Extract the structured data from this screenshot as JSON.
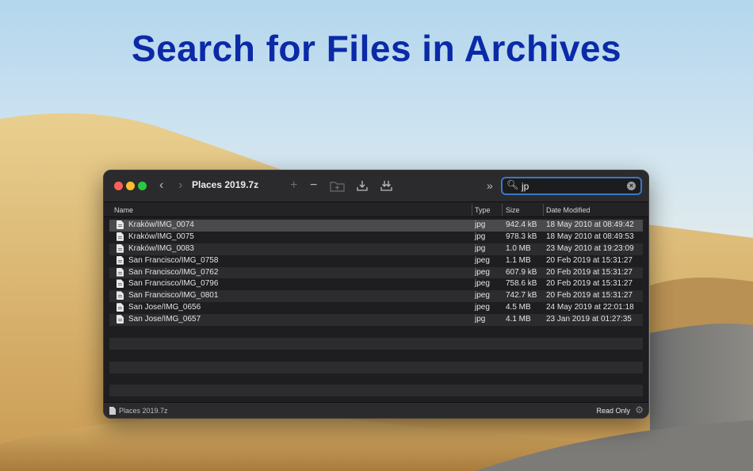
{
  "headline": "Search for Files in Archives",
  "window": {
    "title": "Places 2019.7z",
    "search": {
      "query": "jp",
      "icon": "magnifier-icon"
    },
    "columns": {
      "name": "Name",
      "type": "Type",
      "size": "Size",
      "date": "Date Modified"
    },
    "rows": [
      {
        "name": "Kraków/IMG_0074",
        "type": "jpg",
        "size": "942.4 kB",
        "date": "18 May 2010 at 08:49:42",
        "selected": true
      },
      {
        "name": "Kraków/IMG_0075",
        "type": "jpg",
        "size": "978.3 kB",
        "date": "18 May 2010 at 08:49:53"
      },
      {
        "name": "Kraków/IMG_0083",
        "type": "jpg",
        "size": "1.0 MB",
        "date": "23 May 2010 at 19:23:09"
      },
      {
        "name": "San Francisco/IMG_0758",
        "type": "jpeg",
        "size": "1.1 MB",
        "date": "20 Feb 2019 at 15:31:27"
      },
      {
        "name": "San Francisco/IMG_0762",
        "type": "jpeg",
        "size": "607.9 kB",
        "date": "20 Feb 2019 at 15:31:27"
      },
      {
        "name": "San Francisco/IMG_0796",
        "type": "jpeg",
        "size": "758.6 kB",
        "date": "20 Feb 2019 at 15:31:27"
      },
      {
        "name": "San Francisco/IMG_0801",
        "type": "jpeg",
        "size": "742.7 kB",
        "date": "20 Feb 2019 at 15:31:27"
      },
      {
        "name": "San Jose/IMG_0656",
        "type": "jpeg",
        "size": "4.5 MB",
        "date": "24 May 2019 at 22:01:18"
      },
      {
        "name": "San Jose/IMG_0657",
        "type": "jpg",
        "size": "4.1 MB",
        "date": "23 Jan 2019 at 01:27:35"
      }
    ],
    "status": {
      "archive": "Places 2019.7z",
      "mode": "Read Only"
    }
  },
  "colors": {
    "headline": "#0b2aa8",
    "search_focus": "#3a77c8",
    "window_bg": "#1e1e20"
  }
}
